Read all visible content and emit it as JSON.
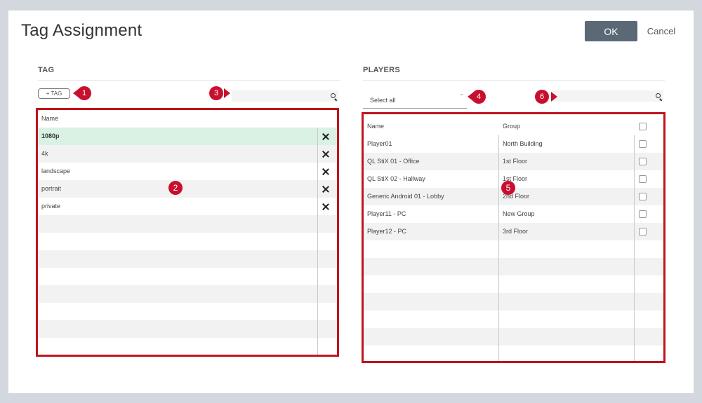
{
  "dialog": {
    "title": "Tag Assignment",
    "ok_label": "OK",
    "cancel_label": "Cancel"
  },
  "tag_section": {
    "title": "TAG",
    "add_tag_label": "+ TAG",
    "search": {
      "value": "",
      "placeholder": ""
    },
    "column_name": "Name",
    "rows": [
      {
        "name": "1080p",
        "selected": true
      },
      {
        "name": "4k"
      },
      {
        "name": "landscape"
      },
      {
        "name": "portrait"
      },
      {
        "name": "private"
      }
    ]
  },
  "players_section": {
    "title": "PLAYERS",
    "select_label": "Select all",
    "search": {
      "value": "",
      "placeholder": ""
    },
    "column_name": "Name",
    "column_group": "Group",
    "rows": [
      {
        "name": "Player01",
        "group": "North Building"
      },
      {
        "name": "QL StiX 01 - Office",
        "group": "1st Floor"
      },
      {
        "name": "QL StiX 02 - Hallway",
        "group": "1st Floor"
      },
      {
        "name": "Generic Android 01 - Lobby",
        "group": "2nd Floor"
      },
      {
        "name": "Player11 - PC",
        "group": "New Group"
      },
      {
        "name": "Player12 - PC",
        "group": "3rd Floor"
      }
    ]
  },
  "callouts": [
    "1",
    "2",
    "3",
    "4",
    "5",
    "6"
  ],
  "icons": {
    "search": "search-icon",
    "delete": "close-icon",
    "dropdown": "chevron-down-icon",
    "checkbox": "checkbox-icon"
  },
  "colors": {
    "accent_ok": "#5b6876",
    "callout": "#c8102e",
    "highlight_border": "#c0141c",
    "selected_row": "#d9f2e3"
  }
}
